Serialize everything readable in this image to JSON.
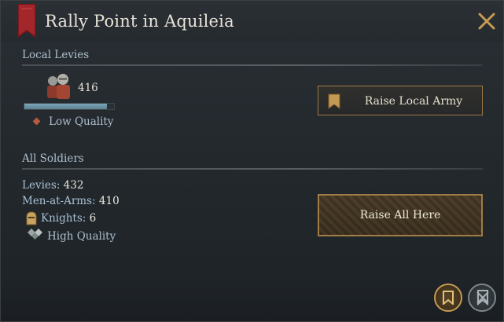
{
  "window": {
    "title": "Rally Point in Aquileia"
  },
  "local_levies": {
    "section_label": "Local Levies",
    "levy_count": "416",
    "levy_fill_fraction": 0.92,
    "quality_label": "Low Quality",
    "raise_button_label": "Raise Local Army"
  },
  "all_soldiers": {
    "section_label": "All Soldiers",
    "levies_label": "Levies:",
    "levies_value": "432",
    "maa_label": "Men-at-Arms:",
    "maa_value": "410",
    "knights_label": "Knights:",
    "knights_value": "6",
    "quality_label": "High Quality",
    "raise_button_label": "Raise All Here"
  },
  "colors": {
    "accent_gold": "#a17c45",
    "banner_red": "#a3262a",
    "low_quality_marker": "#b55a3e"
  },
  "icons": {
    "close": "close-x-icon",
    "banner": "red-banner-icon",
    "soldiers": "soldiers-icon",
    "flag": "army-flag-icon",
    "knight": "knight-helmet-icon",
    "quality": "high-quality-icon"
  }
}
